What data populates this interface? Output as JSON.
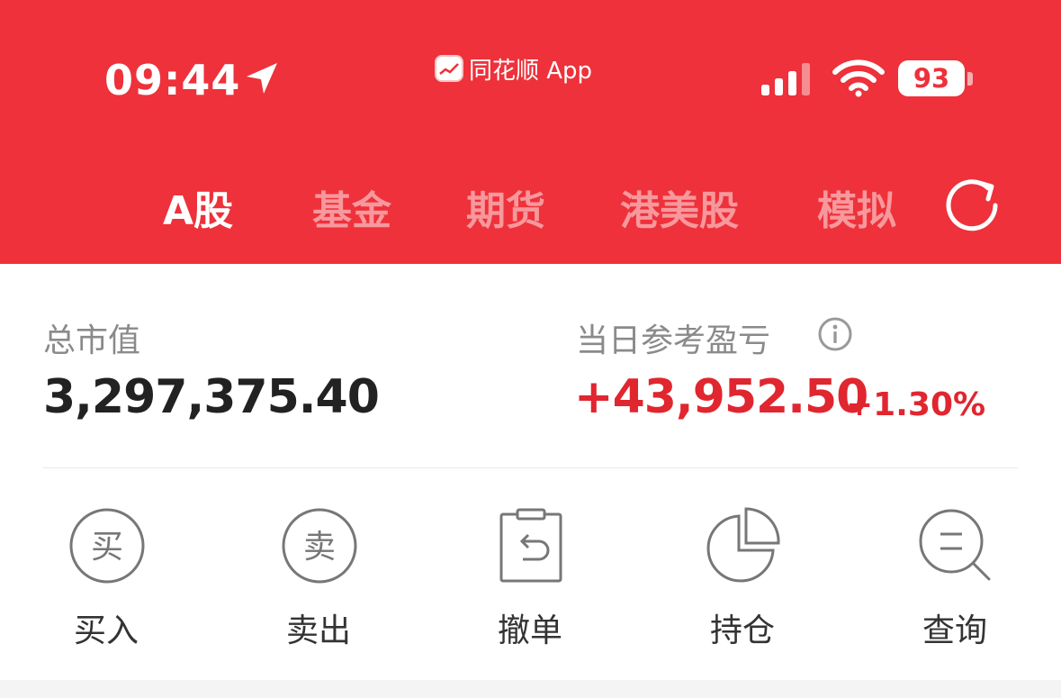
{
  "status_bar": {
    "time": "09:44",
    "source_app": "同花顺 App",
    "battery": "93",
    "icons": [
      "location-arrow-icon",
      "signal-icon",
      "wifi-icon",
      "battery-icon"
    ]
  },
  "tabs": [
    {
      "label": "A股",
      "active": true
    },
    {
      "label": "基金",
      "active": false
    },
    {
      "label": "期货",
      "active": false
    },
    {
      "label": "港美股",
      "active": false
    },
    {
      "label": "模拟",
      "active": false
    }
  ],
  "summary": {
    "total_value_label": "总市值",
    "total_value": "3,297,375.40",
    "daily_pl_label": "当日参考盈亏",
    "daily_pl": "+43,952.50",
    "daily_pl_percent": "+1.30%"
  },
  "actions": [
    {
      "label": "买入",
      "icon": "buy-icon",
      "icon_text": "买"
    },
    {
      "label": "卖出",
      "icon": "sell-icon",
      "icon_text": "卖"
    },
    {
      "label": "撤单",
      "icon": "cancel-order-icon"
    },
    {
      "label": "持仓",
      "icon": "pie-chart-icon"
    },
    {
      "label": "查询",
      "icon": "search-icon"
    }
  ],
  "colors": {
    "header_bg": "#ee313a",
    "profit_red": "#e0262f",
    "text_dark": "#222222",
    "text_gray": "#8a8a8a"
  }
}
